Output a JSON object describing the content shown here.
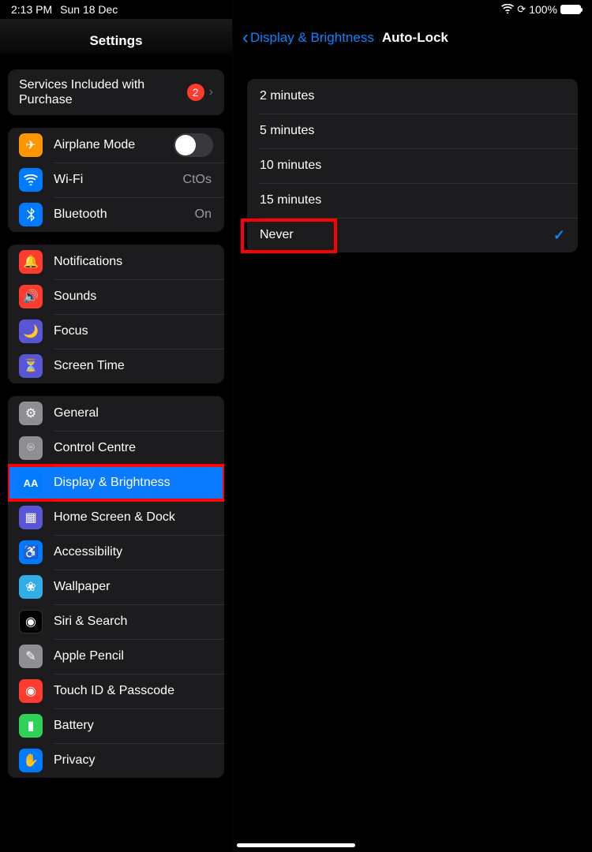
{
  "status": {
    "time": "2:13 PM",
    "date": "Sun 18 Dec",
    "battery_pct": "100%"
  },
  "sidebar": {
    "title": "Settings",
    "top": {
      "label": "Services Included with Purchase",
      "badge": "2"
    },
    "connectivity": {
      "airplane": "Airplane Mode",
      "wifi_label": "Wi-Fi",
      "wifi_value": "CtOs",
      "bt_label": "Bluetooth",
      "bt_value": "On"
    },
    "alerts": {
      "notifications": "Notifications",
      "sounds": "Sounds",
      "focus": "Focus",
      "screen_time": "Screen Time"
    },
    "main": {
      "general": "General",
      "control_centre": "Control Centre",
      "display": "Display & Brightness",
      "home": "Home Screen & Dock",
      "accessibility": "Accessibility",
      "wallpaper": "Wallpaper",
      "siri": "Siri & Search",
      "pencil": "Apple Pencil",
      "touchid": "Touch ID & Passcode",
      "battery": "Battery",
      "privacy": "Privacy"
    }
  },
  "detail": {
    "back": "Display & Brightness",
    "title": "Auto-Lock",
    "options": {
      "o1": "2 minutes",
      "o2": "5 minutes",
      "o3": "10 minutes",
      "o4": "15 minutes",
      "o5": "Never"
    }
  }
}
